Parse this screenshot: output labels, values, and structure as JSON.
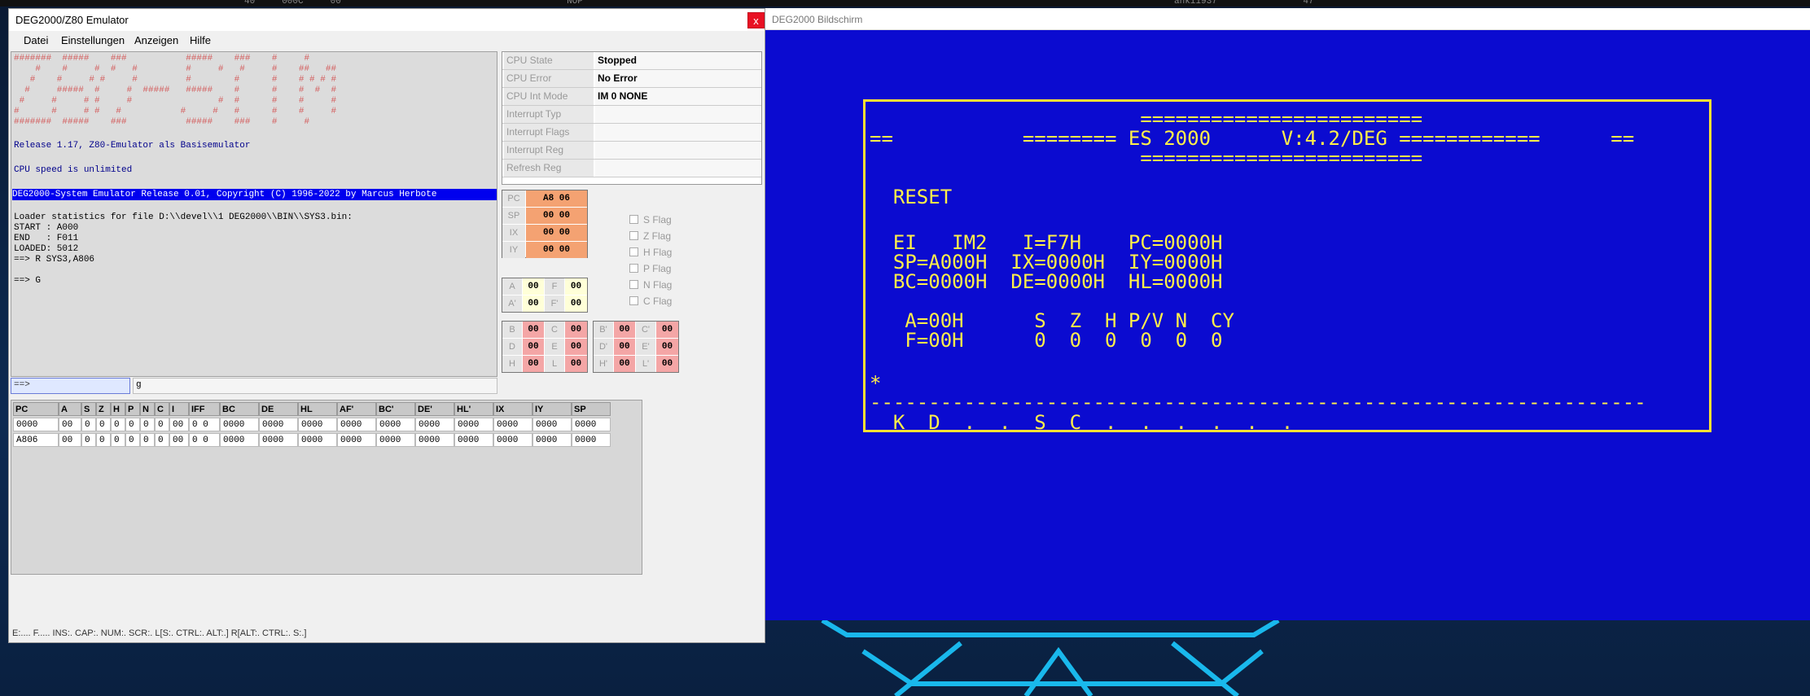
{
  "topbar": {
    "text": "40     000C     00                                          NOP                                                                                                              anki1937                47"
  },
  "emulator": {
    "title": "DEG2000/Z80 Emulator",
    "close": "x",
    "menu": [
      "Datei",
      "Einstellungen",
      "Anzeigen",
      "Hilfe"
    ],
    "console": {
      "banner": [
        "#######  #####    ###           #####    ###    #     #",
        "    #    #     #  #   #         #     #   #     #    ##   ##",
        "   #    #     # #     #         #        #      #    # # # #",
        "  #     #####  #     #  #####   #####    #      #    #  #  #",
        " #     #     # #     #                #  #      #    #     #",
        "#      #     # #   #           #     #   #      #    #     #",
        "#######  #####    ###           #####    ###    #     #"
      ],
      "release": "Release 1.17, Z80-Emulator als Basisemulator",
      "speed": "CPU speed is unlimited",
      "copyright": "DEG2000-System Emulator Release 0.01, Copyright (C) 1996-2022 by Marcus Herbote",
      "loader": [
        "Loader statistics for file D:\\\\devel\\\\1 DEG2000\\\\BIN\\\\SYS3.bin:",
        "START : A000",
        "END   : F011",
        "LOADED: 5012",
        "==> R SYS3,A806",
        "",
        "==> G"
      ]
    },
    "command": {
      "prompt": "==>",
      "echo": "g"
    },
    "cpu": [
      {
        "key": "CPU State",
        "value": "Stopped"
      },
      {
        "key": "CPU Error",
        "value": "No Error"
      },
      {
        "key": "CPU Int Mode",
        "value": "IM 0  NONE"
      },
      {
        "key": "Interrupt Typ",
        "value": ""
      },
      {
        "key": "Interrupt Flags",
        "value": ""
      },
      {
        "key": "Interrupt Reg",
        "value": ""
      },
      {
        "key": "Refresh  Reg",
        "value": ""
      }
    ],
    "pc_regs": [
      {
        "name": "PC",
        "value": "A8 06"
      },
      {
        "name": "SP",
        "value": "00 00"
      },
      {
        "name": "IX",
        "value": "00 00"
      },
      {
        "name": "IY",
        "value": "00 00"
      }
    ],
    "af": [
      {
        "n1": "A",
        "v1": "00",
        "n2": "F",
        "v2": "00"
      },
      {
        "n1": "A'",
        "v1": "00",
        "n2": "F'",
        "v2": "00"
      }
    ],
    "bcdehl": [
      {
        "n1": "B",
        "v1": "00",
        "n2": "C",
        "v2": "00"
      },
      {
        "n1": "D",
        "v1": "00",
        "n2": "E",
        "v2": "00"
      },
      {
        "n1": "H",
        "v1": "00",
        "n2": "L",
        "v2": "00"
      }
    ],
    "bcdehl_alt": [
      {
        "n1": "B'",
        "v1": "00",
        "n2": "C'",
        "v2": "00"
      },
      {
        "n1": "D'",
        "v1": "00",
        "n2": "E'",
        "v2": "00"
      },
      {
        "n1": "H'",
        "v1": "00",
        "n2": "L'",
        "v2": "00"
      }
    ],
    "flags": [
      "S Flag",
      "Z Flag",
      "H Flag",
      "P Flag",
      "N Flag",
      "C Flag"
    ],
    "trace": {
      "headers": [
        "PC",
        "A",
        "S",
        "Z",
        "H",
        "P",
        "N",
        "C",
        "I",
        "IFF",
        "BC",
        "DE",
        "HL",
        "AF'",
        "BC'",
        "DE'",
        "HL'",
        "IX",
        "IY",
        "SP"
      ],
      "rows": [
        [
          "0000",
          "00",
          "0",
          "0",
          "0",
          "0",
          "0",
          "0",
          "00",
          "0 0",
          "0000",
          "0000",
          "0000",
          "0000",
          "0000",
          "0000",
          "0000",
          "0000",
          "0000",
          "0000"
        ],
        [
          "A806",
          "00",
          "0",
          "0",
          "0",
          "0",
          "0",
          "0",
          "00",
          "0 0",
          "0000",
          "0000",
          "0000",
          "0000",
          "0000",
          "0000",
          "0000",
          "0000",
          "0000",
          "0000"
        ]
      ]
    },
    "status": "E:....  F.....  INS:. CAP:. NUM:. SCR:.  L[S:. CTRL:. ALT:.]  R[ALT:. CTRL:. S:.]"
  },
  "screen": {
    "title": "DEG2000 Bildschirm",
    "lines": [
      "                       ========================",
      "==           ======== ES 2000      V:4.2/DEG ============      ==",
      "                       ========================",
      "",
      "  RESET",
      "",
      "  EI   IM2   I=F7H    PC=0000H",
      "  SP=A000H  IX=0000H  IY=0000H",
      "  BC=0000H  DE=0000H  HL=0000H",
      "",
      "   A=00H      S  Z  H P/V N  CY",
      "   F=00H      0  0  0  0  0  0",
      "",
      "*",
      "------------------------------------------------------------------",
      "  K  D  .  .  S  C  .  .  .  .  .  ."
    ]
  }
}
